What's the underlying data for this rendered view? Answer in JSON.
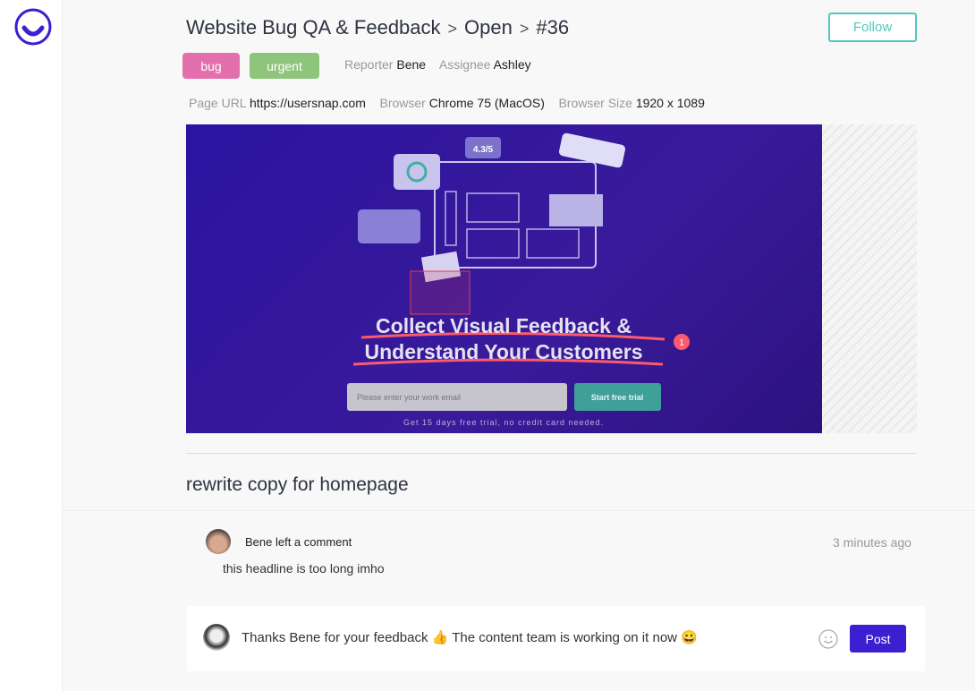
{
  "breadcrumb": {
    "project": "Website Bug QA & Feedback",
    "status": "Open",
    "issue_id": "#36"
  },
  "follow_label": "Follow",
  "tags": [
    {
      "label": "bug",
      "color": "#e46fad"
    },
    {
      "label": "urgent",
      "color": "#8fc57a"
    }
  ],
  "meta": {
    "reporter_label": "Reporter",
    "reporter": "Bene",
    "assignee_label": "Assignee",
    "assignee": "Ashley",
    "page_url_label": "Page URL",
    "page_url": "https://usersnap.com",
    "browser_label": "Browser",
    "browser": "Chrome 75 (MacOS)",
    "browser_size_label": "Browser Size",
    "browser_size": "1920 x 1089"
  },
  "screenshot": {
    "rating": "4.3/5",
    "headline_1": "Collect Visual Feedback &",
    "headline_2": "Understand Your Customers",
    "email_placeholder": "Please enter your work email",
    "cta": "Start free trial",
    "note": "Get 15 days free trial, no credit card needed.",
    "marker": "1"
  },
  "issue_title": "rewrite copy for homepage",
  "comment": {
    "author_line": "Bene left a comment",
    "time": "3 minutes ago",
    "text": "this headline is too long imho"
  },
  "reply": {
    "text": "Thanks Bene for your feedback 👍 The content team is working on it now 😀",
    "post_label": "Post"
  },
  "colors": {
    "accent": "#3b1fd0",
    "follow": "#4fc9c0"
  }
}
